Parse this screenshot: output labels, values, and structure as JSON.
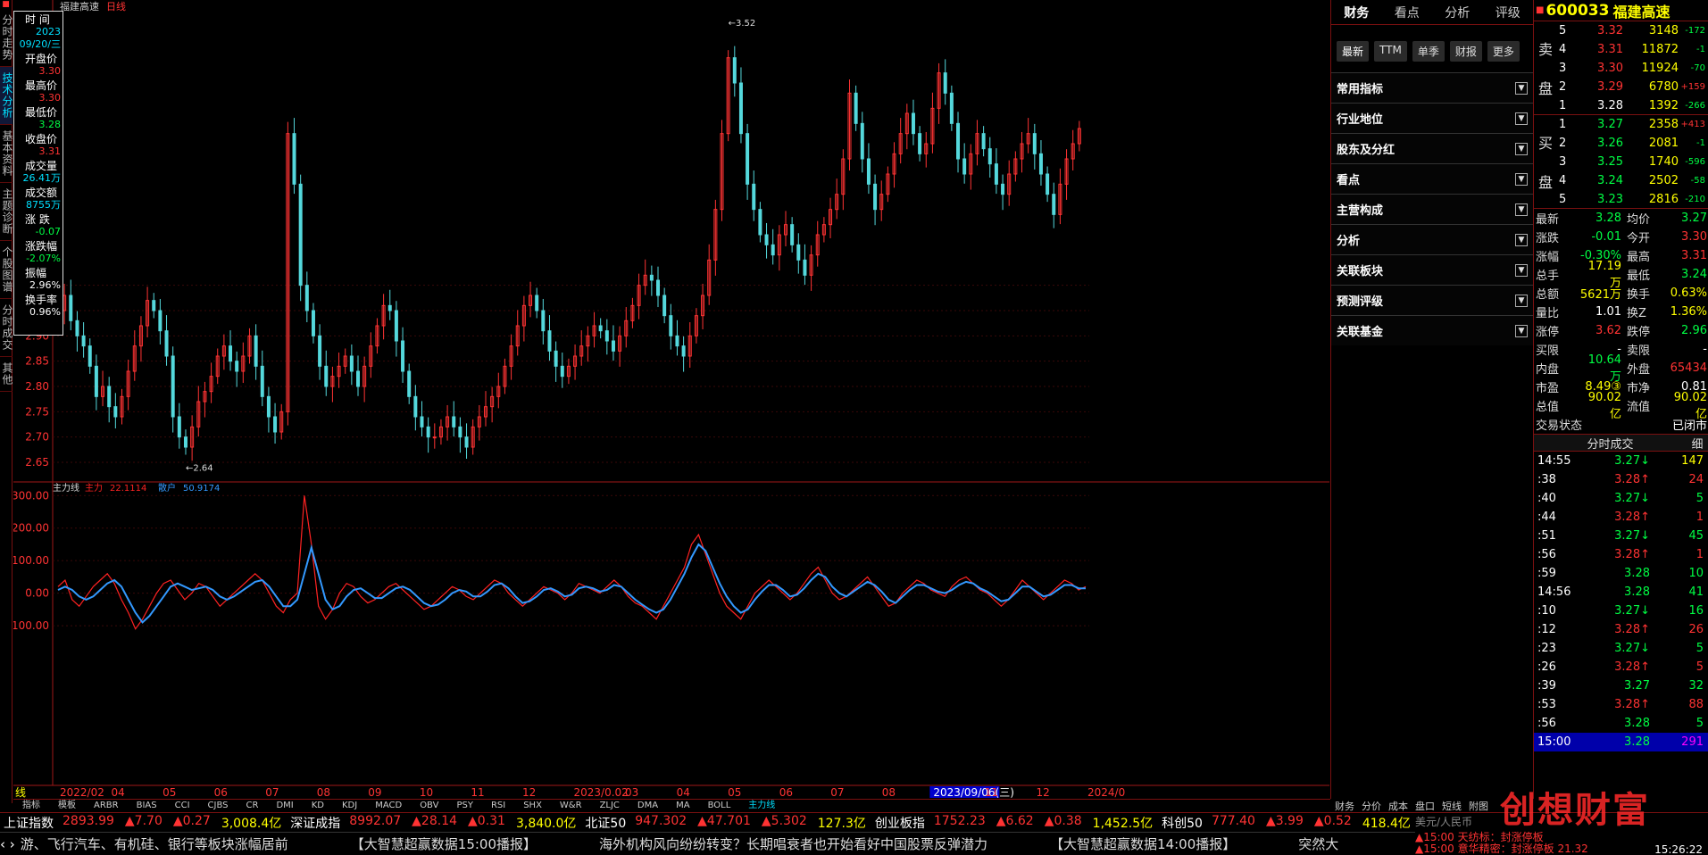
{
  "left_nav": [
    "分时走势",
    "技术分析",
    "基本资料",
    "主题诊断",
    "个股图谱",
    "分时成交",
    "其他"
  ],
  "left_nav_active": 1,
  "chart_header": {
    "name": "福建高速",
    "period": "日线"
  },
  "info_box": {
    "items": [
      {
        "label": "时 间",
        "value": "2023\n09/20/三",
        "color": "#00e0ff"
      },
      {
        "label": "开盘价",
        "value": "3.30",
        "color": "#ff3333"
      },
      {
        "label": "最高价",
        "value": "3.30",
        "color": "#ff3333"
      },
      {
        "label": "最低价",
        "value": "3.28",
        "color": "#00ff44"
      },
      {
        "label": "收盘价",
        "value": "3.31",
        "color": "#ff3333"
      },
      {
        "label": "成交量",
        "value": "26.41万",
        "color": "#00e0ff"
      },
      {
        "label": "成交额",
        "value": "8755万",
        "color": "#00e0ff"
      },
      {
        "label": "涨 跌",
        "value": "-0.07",
        "color": "#00ff44"
      },
      {
        "label": "涨跌幅",
        "value": "-2.07%",
        "color": "#00ff44"
      },
      {
        "label": "振幅",
        "value": "2.96%",
        "color": "#ffffff"
      },
      {
        "label": "换手率",
        "value": "0.96%",
        "color": "#ffffff"
      }
    ]
  },
  "chart_data": [
    {
      "type": "candlestick",
      "title": "福建高速 日线",
      "y_ticks": [
        "3.00",
        "2.95",
        "2.90",
        "2.85",
        "2.80",
        "2.75",
        "2.70",
        "2.65"
      ],
      "ylim": [
        2.62,
        3.55
      ],
      "annotations": [
        {
          "text": "←2.64",
          "value": 2.64
        },
        {
          "text": "←3.52",
          "value": 3.52
        }
      ],
      "x_ticks": [
        "2022/02",
        "04",
        "05",
        "06",
        "07",
        "08",
        "09",
        "10",
        "11",
        "12",
        "2023/0.02",
        "03",
        "04",
        "05",
        "06",
        "07",
        "08",
        "2023/09/06(三)",
        "11",
        "12",
        "2024/0"
      ],
      "series": [
        {
          "name": "收盘价",
          "values": [
            2.95,
            2.98,
            2.93,
            2.9,
            2.88,
            2.84,
            2.78,
            2.8,
            2.76,
            2.74,
            2.78,
            2.83,
            2.88,
            2.92,
            2.97,
            2.95,
            2.91,
            2.86,
            2.74,
            2.7,
            2.68,
            2.72,
            2.77,
            2.79,
            2.82,
            2.86,
            2.88,
            2.85,
            2.83,
            2.86,
            2.9,
            2.84,
            2.78,
            2.74,
            2.71,
            2.75,
            3.3,
            3.2,
            3.0,
            2.95,
            2.9,
            2.84,
            2.8,
            2.82,
            2.84,
            2.86,
            2.83,
            2.8,
            2.84,
            2.88,
            2.92,
            2.96,
            2.95,
            2.89,
            2.83,
            2.78,
            2.74,
            2.72,
            2.7,
            2.7,
            2.72,
            2.74,
            2.72,
            2.7,
            2.68,
            2.72,
            2.74,
            2.76,
            2.78,
            2.8,
            2.84,
            2.88,
            2.92,
            2.96,
            2.98,
            2.95,
            2.91,
            2.87,
            2.84,
            2.82,
            2.84,
            2.86,
            2.88,
            2.9,
            2.92,
            2.91,
            2.89,
            2.87,
            2.9,
            2.93,
            2.96,
            3.0,
            3.02,
            3.01,
            2.98,
            2.94,
            2.9,
            2.88,
            2.86,
            2.9,
            2.94,
            2.98,
            3.05,
            3.15,
            3.3,
            3.45,
            3.4,
            3.3,
            3.2,
            3.15,
            3.1,
            3.08,
            3.06,
            3.1,
            3.12,
            3.08,
            3.05,
            3.02,
            3.06,
            3.1,
            3.12,
            3.15,
            3.18,
            3.25,
            3.38,
            3.32,
            3.25,
            3.2,
            3.15,
            3.18,
            3.22,
            3.26,
            3.3,
            3.34,
            3.3,
            3.26,
            3.28,
            3.35,
            3.42,
            3.38,
            3.32,
            3.25,
            3.22,
            3.26,
            3.3,
            3.27,
            3.24,
            3.2,
            3.18,
            3.22,
            3.25,
            3.28,
            3.3,
            3.26,
            3.22,
            3.18,
            3.14,
            3.2,
            3.25,
            3.28,
            3.31
          ]
        }
      ]
    },
    {
      "type": "line",
      "title": "主力线",
      "legend": [
        {
          "name": "主力",
          "value": "22.1114",
          "color": "#ff2222"
        },
        {
          "name": "散户",
          "value": "50.9174",
          "color": "#3399ff"
        }
      ],
      "y_ticks": [
        "300.00",
        "200.00",
        "100.00",
        "0.00",
        "-100.00"
      ],
      "ylim": [
        -130,
        320
      ],
      "series": [
        {
          "name": "主力",
          "values": [
            20,
            40,
            -20,
            -40,
            -10,
            20,
            40,
            60,
            30,
            -20,
            -60,
            -110,
            -80,
            -40,
            0,
            30,
            40,
            10,
            -20,
            0,
            30,
            20,
            -10,
            -40,
            -20,
            0,
            20,
            40,
            60,
            40,
            0,
            -40,
            -60,
            -20,
            0,
            300,
            150,
            -40,
            -80,
            -50,
            0,
            30,
            20,
            -10,
            -30,
            -20,
            0,
            20,
            30,
            10,
            -10,
            -30,
            -50,
            -40,
            -20,
            0,
            20,
            10,
            -10,
            -20,
            0,
            20,
            40,
            30,
            0,
            -20,
            -40,
            -20,
            0,
            20,
            10,
            0,
            -20,
            0,
            30,
            20,
            10,
            0,
            20,
            40,
            20,
            -10,
            -30,
            -40,
            -60,
            -80,
            -40,
            0,
            40,
            80,
            150,
            180,
            120,
            60,
            0,
            -40,
            -60,
            -80,
            -40,
            0,
            20,
            40,
            20,
            0,
            -20,
            0,
            30,
            60,
            80,
            40,
            0,
            -20,
            -10,
            10,
            30,
            50,
            20,
            -10,
            -40,
            -30,
            0,
            20,
            40,
            30,
            10,
            0,
            -10,
            20,
            40,
            50,
            30,
            10,
            0,
            -20,
            -40,
            -20,
            10,
            40,
            20,
            0,
            -20,
            0,
            20,
            40,
            30,
            10,
            20
          ]
        },
        {
          "name": "散户",
          "values": [
            10,
            20,
            10,
            -10,
            -20,
            -10,
            10,
            30,
            40,
            20,
            -20,
            -60,
            -90,
            -70,
            -40,
            -10,
            20,
            30,
            20,
            10,
            15,
            20,
            10,
            -10,
            -20,
            -10,
            5,
            20,
            35,
            40,
            20,
            -10,
            -40,
            -40,
            -20,
            60,
            140,
            60,
            -20,
            -50,
            -40,
            -10,
            10,
            15,
            0,
            -15,
            -15,
            0,
            15,
            20,
            10,
            -10,
            -30,
            -40,
            -35,
            -20,
            0,
            10,
            5,
            -10,
            -10,
            5,
            25,
            30,
            15,
            -10,
            -30,
            -25,
            -10,
            10,
            15,
            5,
            -10,
            -5,
            15,
            20,
            15,
            5,
            10,
            25,
            20,
            0,
            -20,
            -35,
            -50,
            -60,
            -50,
            -20,
            20,
            60,
            110,
            150,
            130,
            80,
            30,
            -10,
            -40,
            -60,
            -50,
            -20,
            5,
            25,
            25,
            10,
            -10,
            -5,
            15,
            40,
            60,
            50,
            20,
            0,
            -10,
            5,
            20,
            35,
            25,
            5,
            -20,
            -30,
            -10,
            10,
            25,
            25,
            15,
            5,
            0,
            10,
            25,
            35,
            30,
            15,
            5,
            -10,
            -25,
            -20,
            0,
            20,
            20,
            5,
            -10,
            -5,
            10,
            25,
            25,
            15,
            15
          ]
        }
      ]
    }
  ],
  "indicator_tabs": [
    "指标",
    "模板",
    "ARBR",
    "BIAS",
    "CCI",
    "CJBS",
    "CR",
    "DMI",
    "KD",
    "KDJ",
    "MACD",
    "OBV",
    "PSY",
    "RSI",
    "SHX",
    "W&R",
    "ZLJC",
    "DMA",
    "MA",
    "BOLL",
    "主力线"
  ],
  "indicator_active": 20,
  "period_label": "日线",
  "rp1": {
    "tabs": [
      "财务",
      "看点",
      "分析",
      "评级"
    ],
    "active_tab": 0,
    "buttons": [
      "最新",
      "TTM",
      "单季",
      "财报",
      "更多"
    ],
    "sections": [
      "常用指标",
      "行业地位",
      "股东及分红",
      "看点",
      "主营构成",
      "分析",
      "关联板块",
      "预测评级",
      "关联基金"
    ],
    "bottom_tabs": [
      "财务",
      "分价",
      "成本",
      "盘口",
      "短线",
      "附图"
    ]
  },
  "quote": {
    "code": "600033",
    "name": "福建高速",
    "sell_label": "卖盘",
    "buy_label": "买盘",
    "sells": [
      {
        "lv": "5",
        "price": "3.32",
        "vol": "3148",
        "chg": "-172"
      },
      {
        "lv": "4",
        "price": "3.31",
        "vol": "11872",
        "chg": "-1"
      },
      {
        "lv": "3",
        "price": "3.30",
        "vol": "11924",
        "chg": "-70"
      },
      {
        "lv": "2",
        "price": "3.29",
        "vol": "6780",
        "chg": "+159"
      },
      {
        "lv": "1",
        "price": "3.28",
        "vol": "1392",
        "chg": "-266"
      }
    ],
    "buys": [
      {
        "lv": "1",
        "price": "3.27",
        "vol": "2358",
        "chg": "+413"
      },
      {
        "lv": "2",
        "price": "3.26",
        "vol": "2081",
        "chg": "-1"
      },
      {
        "lv": "3",
        "price": "3.25",
        "vol": "1740",
        "chg": "-596"
      },
      {
        "lv": "4",
        "price": "3.24",
        "vol": "2502",
        "chg": "-58"
      },
      {
        "lv": "5",
        "price": "3.23",
        "vol": "2816",
        "chg": "-210"
      }
    ],
    "stats": [
      {
        "l1": "最新",
        "v1": "3.28",
        "c1": "#00ff44",
        "l2": "均价",
        "v2": "3.27",
        "c2": "#00ff44"
      },
      {
        "l1": "涨跌",
        "v1": "-0.01",
        "c1": "#00ff44",
        "l2": "今开",
        "v2": "3.30",
        "c2": "#ff3333"
      },
      {
        "l1": "涨幅",
        "v1": "-0.30%",
        "c1": "#00ff44",
        "l2": "最高",
        "v2": "3.31",
        "c2": "#ff3333"
      },
      {
        "l1": "总手",
        "v1": "17.19万",
        "c1": "#ffff00",
        "l2": "最低",
        "v2": "3.24",
        "c2": "#00ff44"
      },
      {
        "l1": "总额",
        "v1": "5621万",
        "c1": "#ffff00",
        "l2": "换手",
        "v2": "0.63%",
        "c2": "#ffff00"
      },
      {
        "l1": "量比",
        "v1": "1.01",
        "c1": "#ffffff",
        "l2": "换Z",
        "v2": "1.36%",
        "c2": "#ffff00"
      },
      {
        "l1": "涨停",
        "v1": "3.62",
        "c1": "#ff3333",
        "l2": "跌停",
        "v2": "2.96",
        "c2": "#00ff44"
      },
      {
        "l1": "买限",
        "v1": "-",
        "c1": "#ffffff",
        "l2": "卖限",
        "v2": "-",
        "c2": "#ffffff"
      },
      {
        "l1": "内盘",
        "v1": "10.64万",
        "c1": "#00ff44",
        "l2": "外盘",
        "v2": "65434",
        "c2": "#ff3333"
      },
      {
        "l1": "市盈",
        "v1": "8.49③",
        "c1": "#ffff00",
        "l2": "市净",
        "v2": "0.81",
        "c2": "#ffffff"
      },
      {
        "l1": "总值",
        "v1": "90.02亿",
        "c1": "#ffff00",
        "l2": "流值",
        "v2": "90.02亿",
        "c2": "#ffff00"
      },
      {
        "l1": "交易状态",
        "v1": "",
        "c1": "#ffffff",
        "l2": "",
        "v2": "已闭市",
        "c2": "#ffffff"
      }
    ],
    "trade_header": "分时成交",
    "trade_header_right": "细",
    "trades": [
      {
        "t": "14:55",
        "p": "3.27↓",
        "v": "147",
        "pc": "#00ff44",
        "vc": "#ffff00"
      },
      {
        "t": ":38",
        "p": "3.28↑",
        "v": "24",
        "pc": "#ff3333",
        "vc": "#ff3333"
      },
      {
        "t": ":40",
        "p": "3.27↓",
        "v": "5",
        "pc": "#00ff44",
        "vc": "#00ff44"
      },
      {
        "t": ":44",
        "p": "3.28↑",
        "v": "1",
        "pc": "#ff3333",
        "vc": "#ff3333"
      },
      {
        "t": ":51",
        "p": "3.27↓",
        "v": "45",
        "pc": "#00ff44",
        "vc": "#00ff44"
      },
      {
        "t": ":56",
        "p": "3.28↑",
        "v": "1",
        "pc": "#ff3333",
        "vc": "#ff3333"
      },
      {
        "t": ":59",
        "p": "3.28",
        "v": "10",
        "pc": "#00ff44",
        "vc": "#00ff44"
      },
      {
        "t": "14:56",
        "p": "3.28",
        "v": "41",
        "pc": "#00ff44",
        "vc": "#00ff44"
      },
      {
        "t": ":10",
        "p": "3.27↓",
        "v": "16",
        "pc": "#00ff44",
        "vc": "#00ff44"
      },
      {
        "t": ":12",
        "p": "3.28↑",
        "v": "26",
        "pc": "#ff3333",
        "vc": "#ff3333"
      },
      {
        "t": ":23",
        "p": "3.27↓",
        "v": "5",
        "pc": "#00ff44",
        "vc": "#00ff44"
      },
      {
        "t": ":26",
        "p": "3.28↑",
        "v": "5",
        "pc": "#ff3333",
        "vc": "#ff3333"
      },
      {
        "t": ":39",
        "p": "3.27",
        "v": "32",
        "pc": "#00ff44",
        "vc": "#00ff44"
      },
      {
        "t": ":53",
        "p": "3.28↑",
        "v": "88",
        "pc": "#ff3333",
        "vc": "#ff3333"
      },
      {
        "t": ":56",
        "p": "3.28",
        "v": "5",
        "pc": "#00ff44",
        "vc": "#00ff44"
      },
      {
        "t": "15:00",
        "p": "3.28",
        "v": "291",
        "pc": "#00ff44",
        "vc": "#ff00ff"
      }
    ]
  },
  "ticker": [
    {
      "name": "上证指数",
      "price": "2893.99",
      "chg": "▲7.70",
      "pct": "▲0.27",
      "amt": "3,008.4亿"
    },
    {
      "name": "深证成指",
      "price": "8992.07",
      "chg": "▲28.14",
      "pct": "▲0.31",
      "amt": "3,840.0亿"
    },
    {
      "name": "北证50",
      "price": "947.302",
      "chg": "▲47.701",
      "pct": "▲5.302",
      "amt": "127.3亿"
    },
    {
      "name": "创业板指",
      "price": "1752.23",
      "chg": "▲6.62",
      "pct": "▲0.38",
      "amt": "1,452.5亿"
    },
    {
      "name": "科创50",
      "price": "777.40",
      "chg": "▲3.99",
      "pct": "▲0.52",
      "amt": "418.4亿"
    }
  ],
  "news": [
    "游、飞行汽车、有机硅、银行等板块涨幅居前",
    "【大智慧超赢数据15:00播报】",
    "海外机构风向纷纷转变？长期唱衰者也开始看好中国股票反弹潜力",
    "【大智慧超赢数据14:00播报】",
    "突然大"
  ],
  "status_right": {
    "line1": "▲15:00 天纺标：封涨停板",
    "line2": "▲15:00 意华精密：封涨停板 21.32",
    "time": "15:26:22",
    "currency": "美元/人民币"
  },
  "watermark": "创想财富"
}
